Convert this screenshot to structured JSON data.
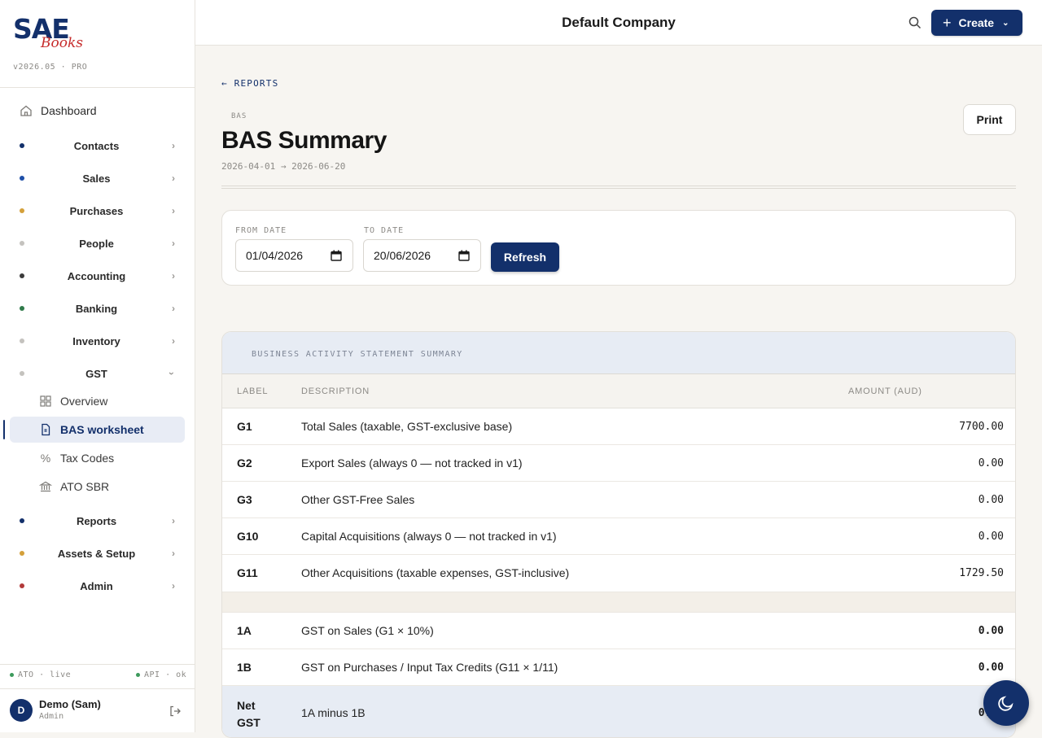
{
  "brand": {
    "name": "SAE",
    "sub": "Books",
    "version": "v2026.05 · PRO"
  },
  "nav": {
    "dashboard": "Dashboard",
    "groups": [
      {
        "label": "Contacts",
        "color": "#13306b"
      },
      {
        "label": "Sales",
        "color": "#1e4fa8"
      },
      {
        "label": "Purchases",
        "color": "#d4a03a"
      },
      {
        "label": "People",
        "color": "#c4c2be"
      },
      {
        "label": "Accounting",
        "color": "#3b3b3b"
      },
      {
        "label": "Banking",
        "color": "#2f7a4a"
      },
      {
        "label": "Inventory",
        "color": "#c4c2be"
      },
      {
        "label": "GST",
        "color": "#c4c2be"
      },
      {
        "label": "Reports",
        "color": "#13306b"
      },
      {
        "label": "Assets & Setup",
        "color": "#d4a03a"
      },
      {
        "label": "Admin",
        "color": "#b23a3a"
      }
    ],
    "gst_items": [
      "Overview",
      "BAS worksheet",
      "Tax Codes",
      "ATO SBR"
    ]
  },
  "status": {
    "ato": "ATO · live",
    "api": "API · ok"
  },
  "user": {
    "initial": "D",
    "name": "Demo (Sam)",
    "role": "Admin"
  },
  "topbar": {
    "company": "Default Company",
    "create_label": "Create"
  },
  "page": {
    "back": "← REPORTS",
    "eyebrow": "BAS",
    "title": "BAS Summary",
    "range": "2026-04-01 → 2026-06-20",
    "print": "Print"
  },
  "filters": {
    "from_label": "FROM DATE",
    "from_value": "01/04/2026",
    "to_label": "TO DATE",
    "to_value": "20/06/2026",
    "refresh": "Refresh"
  },
  "table": {
    "heading": "BUSINESS ACTIVITY STATEMENT SUMMARY",
    "columns": [
      "LABEL",
      "DESCRIPTION",
      "AMOUNT (AUD)"
    ],
    "rows": [
      {
        "code": "G1",
        "desc": "Total Sales (taxable, GST-exclusive base)",
        "amount": "7700.00"
      },
      {
        "code": "G2",
        "desc": "Export Sales (always 0 — not tracked in v1)",
        "amount": "0.00"
      },
      {
        "code": "G3",
        "desc": "Other GST-Free Sales",
        "amount": "0.00"
      },
      {
        "code": "G10",
        "desc": "Capital Acquisitions (always 0 — not tracked in v1)",
        "amount": "0.00"
      },
      {
        "code": "G11",
        "desc": "Other Acquisitions (taxable expenses, GST-inclusive)",
        "amount": "1729.50"
      }
    ],
    "gst_rows": [
      {
        "code": "1A",
        "desc": "GST on Sales (G1 × 10%)",
        "amount": "0.00"
      },
      {
        "code": "1B",
        "desc": "GST on Purchases / Input Tax Credits (G11 × 1/11)",
        "amount": "0.00"
      }
    ],
    "net": {
      "code_line1": "Net",
      "code_line2": "GST",
      "desc": "1A minus 1B",
      "amount": "0.00"
    }
  },
  "colors": {
    "primary": "#13306b",
    "accent_red": "#c62b2b"
  }
}
